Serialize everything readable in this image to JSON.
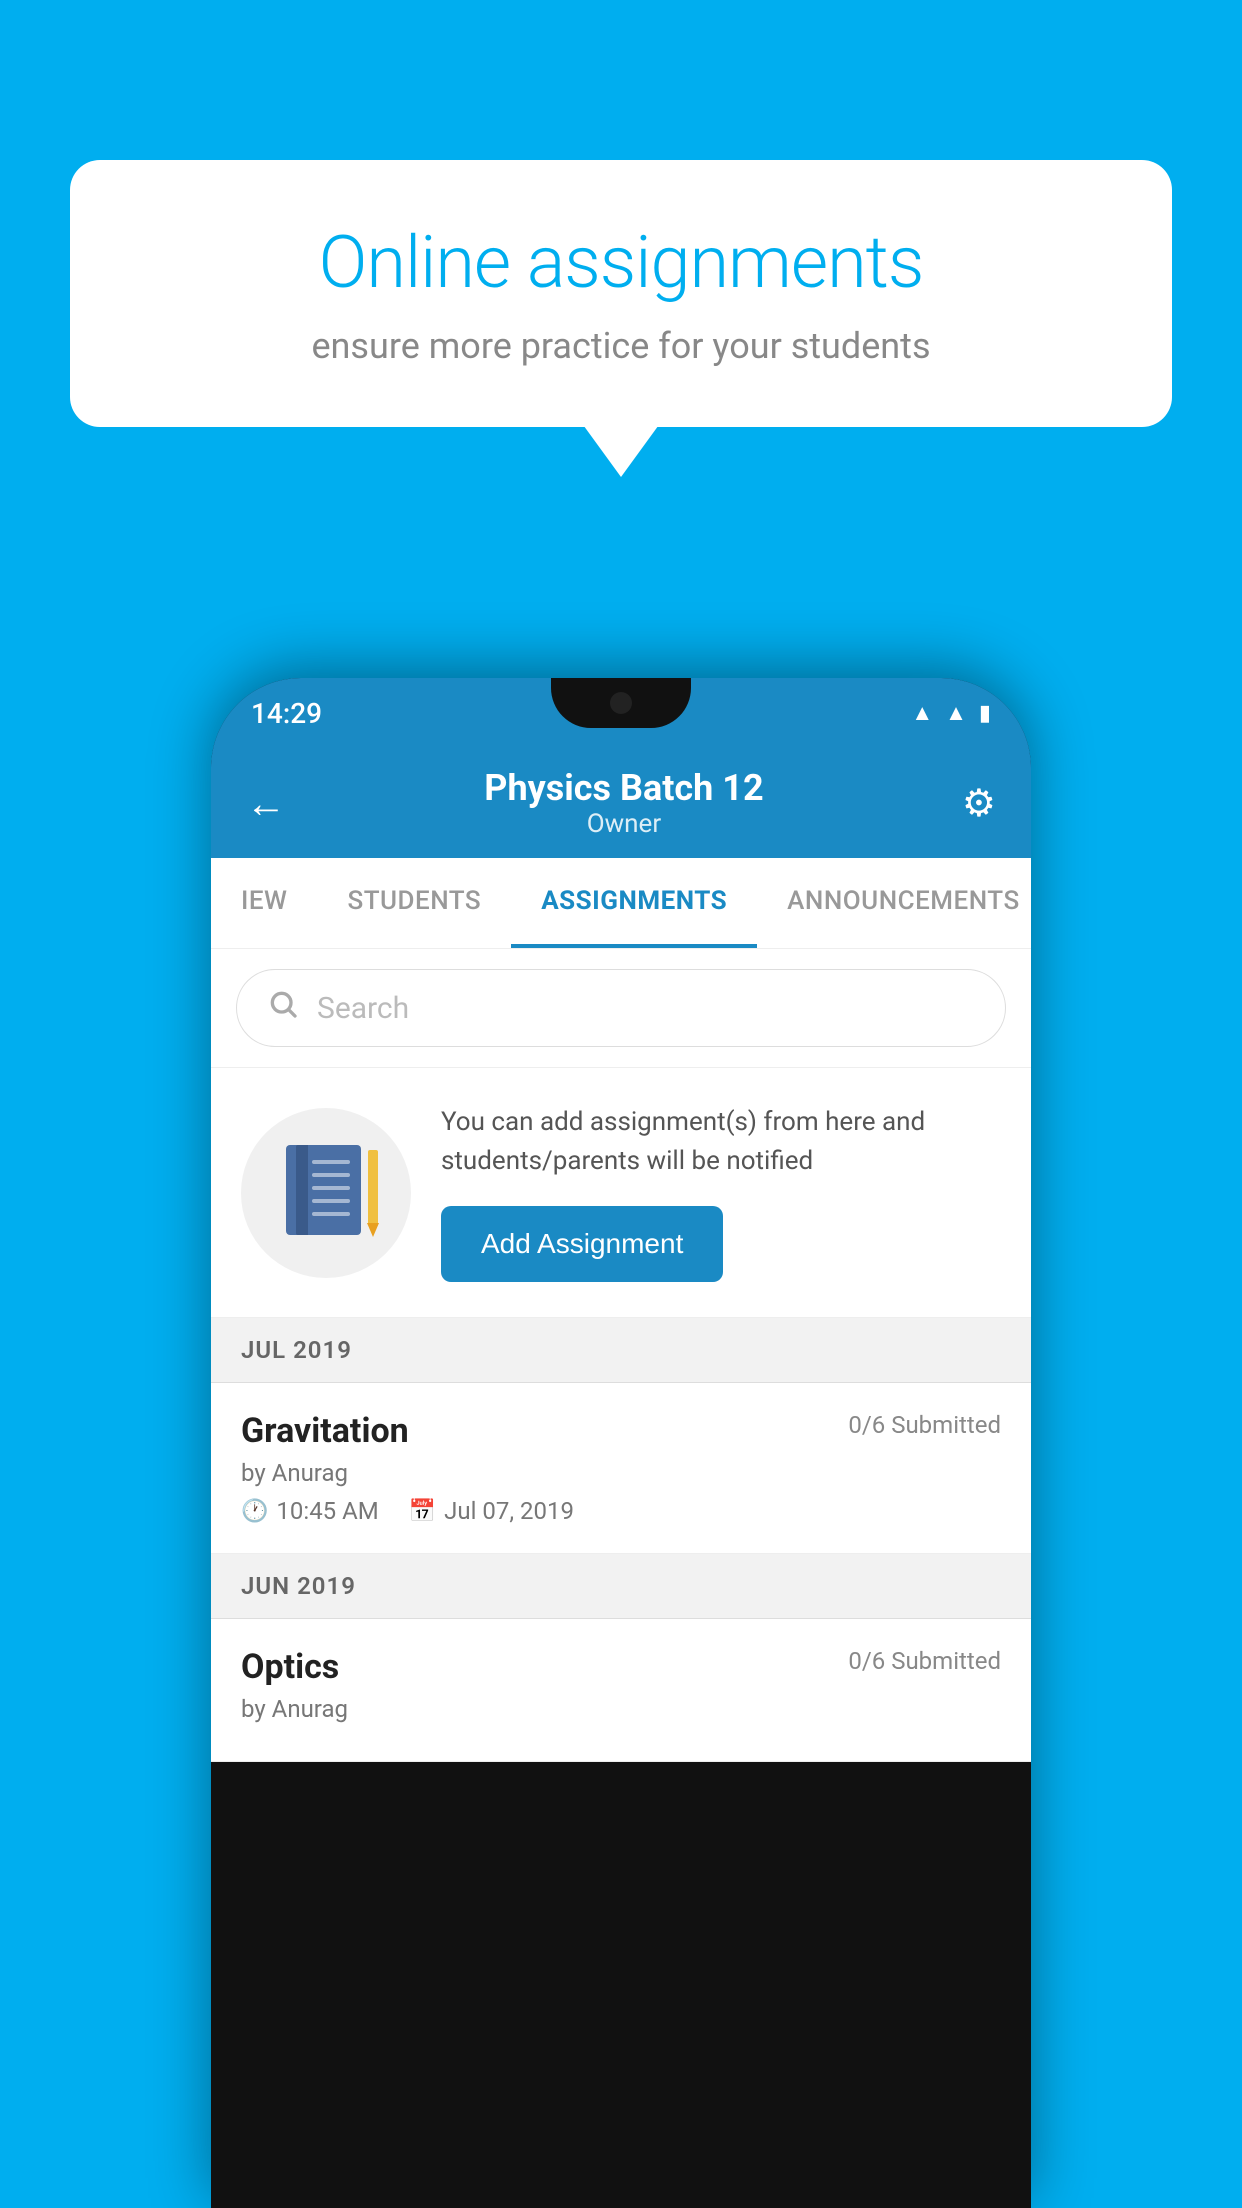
{
  "background_color": "#00AEEF",
  "speech_bubble": {
    "title": "Online assignments",
    "subtitle": "ensure more practice for your students"
  },
  "phone": {
    "status_bar": {
      "time": "14:29"
    },
    "header": {
      "title": "Physics Batch 12",
      "subtitle": "Owner",
      "back_label": "←",
      "settings_label": "⚙"
    },
    "tabs": [
      {
        "label": "IEW",
        "active": false
      },
      {
        "label": "STUDENTS",
        "active": false
      },
      {
        "label": "ASSIGNMENTS",
        "active": true
      },
      {
        "label": "ANNOUNCEMENTS",
        "active": false
      }
    ],
    "search": {
      "placeholder": "Search"
    },
    "promo": {
      "description": "You can add assignment(s) from here and students/parents will be notified",
      "button_label": "Add Assignment"
    },
    "sections": [
      {
        "header": "JUL 2019",
        "assignments": [
          {
            "name": "Gravitation",
            "submitted": "0/6 Submitted",
            "by": "by Anurag",
            "time": "10:45 AM",
            "date": "Jul 07, 2019"
          }
        ]
      },
      {
        "header": "JUN 2019",
        "assignments": [
          {
            "name": "Optics",
            "submitted": "0/6 Submitted",
            "by": "by Anurag",
            "time": "",
            "date": ""
          }
        ]
      }
    ]
  }
}
